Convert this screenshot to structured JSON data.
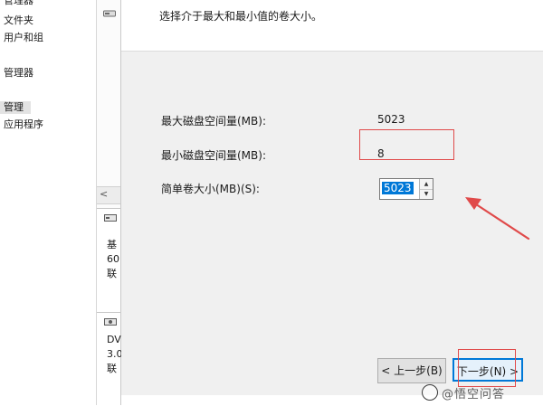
{
  "nav": {
    "items": [
      {
        "label": "管理器",
        "cut": true
      },
      {
        "label": "文件夹"
      },
      {
        "label": "用户和组"
      },
      {
        "label": "管理器"
      },
      {
        "label": "管理",
        "selected": true
      },
      {
        "label": "应用程序"
      }
    ]
  },
  "disks": [
    {
      "line1": "基",
      "line2": "60",
      "line3": "联"
    },
    {
      "line1": "DV",
      "line2": "3.0",
      "line3": "联"
    }
  ],
  "wizard": {
    "description": "选择介于最大和最小值的卷大小。",
    "max_label": "最大磁盘空间量(MB):",
    "max_value": "5023",
    "min_label": "最小磁盘空间量(MB):",
    "min_value": "8",
    "size_label": "简单卷大小(MB)(S):",
    "size_value": "5023",
    "back_label": "< 上一步(B)",
    "next_label": "下一步(N) >"
  },
  "watermark": {
    "text": "@悟空问答"
  },
  "colors": {
    "annotation": "#e04a4a",
    "selection": "#0078d7"
  }
}
